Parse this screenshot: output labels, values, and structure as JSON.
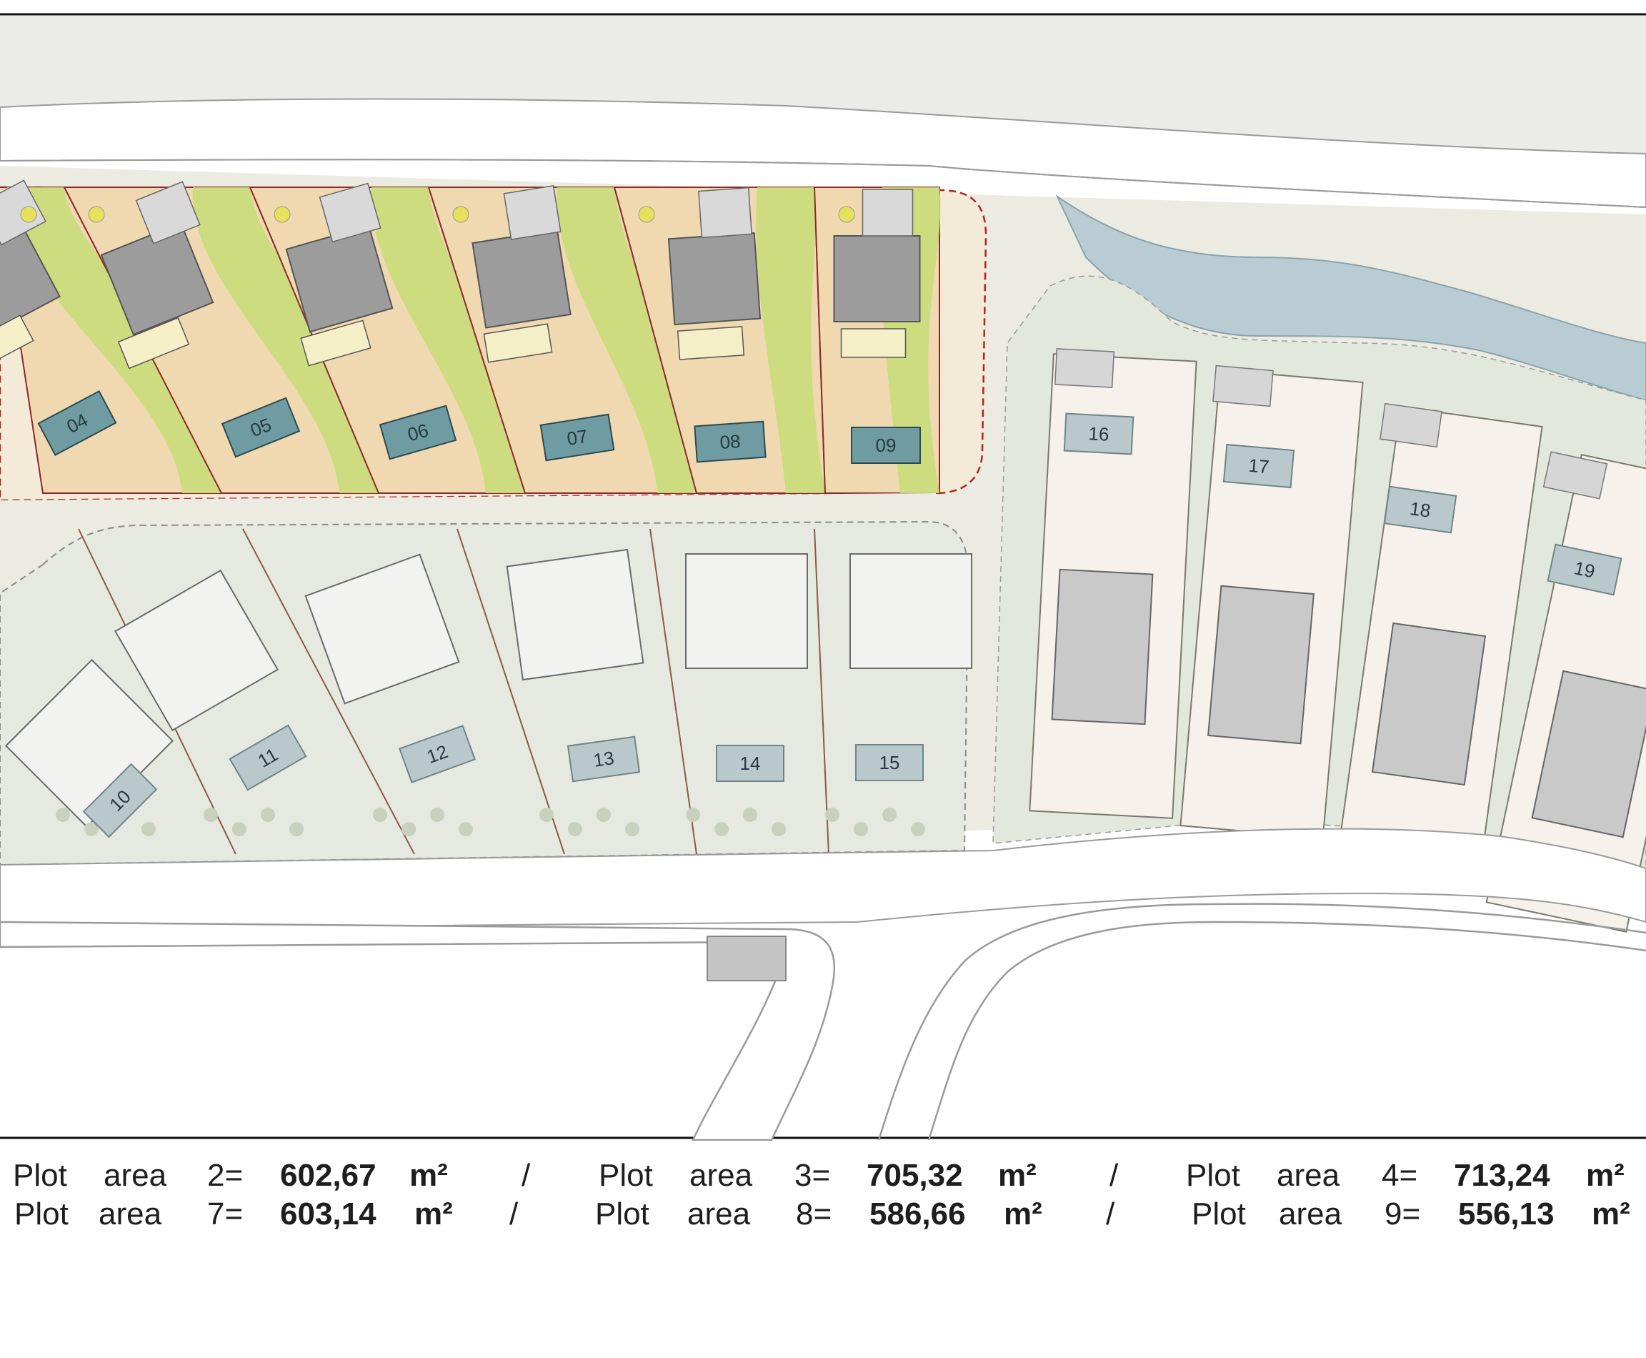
{
  "plots_upper_row": [
    {
      "label": "04"
    },
    {
      "label": "05"
    },
    {
      "label": "06"
    },
    {
      "label": "07"
    },
    {
      "label": "08"
    },
    {
      "label": "09"
    }
  ],
  "plots_lower_row": [
    {
      "label": "10"
    },
    {
      "label": "11"
    },
    {
      "label": "12"
    },
    {
      "label": "13"
    },
    {
      "label": "14"
    },
    {
      "label": "15"
    }
  ],
  "plots_right_row": [
    {
      "label": "16"
    },
    {
      "label": "17"
    },
    {
      "label": "18"
    },
    {
      "label": "19"
    }
  ],
  "legend": {
    "rows": [
      {
        "items": [
          {
            "prefix": "Plot",
            "word": "area",
            "num": "2=",
            "value": "602,67",
            "unit": "m²",
            "sep": "/"
          },
          {
            "prefix": "Plot",
            "word": "area",
            "num": "3=",
            "value": "705,32",
            "unit": "m²",
            "sep": "/"
          },
          {
            "prefix": "Plot",
            "word": "area",
            "num": "4=",
            "value": "713,24",
            "unit": "m²",
            "sep": ""
          }
        ]
      },
      {
        "items": [
          {
            "prefix": "Plot",
            "word": "area",
            "num": "7=",
            "value": "603,14",
            "unit": "m²",
            "sep": "/"
          },
          {
            "prefix": "Plot",
            "word": "area",
            "num": "8=",
            "value": "586,66",
            "unit": "m²",
            "sep": "/"
          },
          {
            "prefix": "Plot",
            "word": "area",
            "num": "9=",
            "value": "556,13",
            "unit": "m²",
            "sep": ""
          }
        ]
      }
    ]
  },
  "colors": {
    "lawn": "#c9dc7a",
    "deck": "#f0d9b0",
    "pool": "#6f9ca3",
    "pool_pale": "#b9c9cb",
    "river": "#b9ccd3",
    "roof": "#9c9c9c",
    "garden_pale": "#e3e8dc",
    "boundary_dashed": "#b22222"
  }
}
